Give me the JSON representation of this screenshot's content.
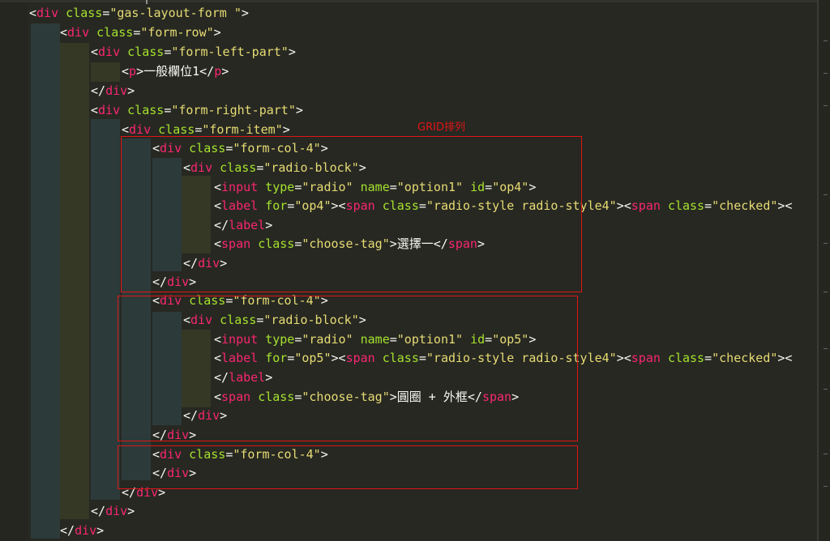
{
  "annotation": "GRID排列",
  "lines": [
    [
      [
        "p",
        "<"
      ],
      [
        "t",
        "div"
      ],
      [
        "p",
        " "
      ],
      [
        "a",
        "class"
      ],
      [
        "p",
        "="
      ],
      [
        "s",
        "\"gas-layout-form \""
      ],
      [
        "p",
        ">"
      ]
    ],
    [
      [
        "p",
        "<"
      ],
      [
        "t",
        "div"
      ],
      [
        "p",
        " "
      ],
      [
        "a",
        "class"
      ],
      [
        "p",
        "="
      ],
      [
        "s",
        "\"form-row\""
      ],
      [
        "p",
        ">"
      ]
    ],
    [
      [
        "p",
        "<"
      ],
      [
        "t",
        "div"
      ],
      [
        "p",
        " "
      ],
      [
        "a",
        "class"
      ],
      [
        "p",
        "="
      ],
      [
        "s",
        "\"form-left-part\""
      ],
      [
        "p",
        ">"
      ]
    ],
    [
      [
        "p",
        "<"
      ],
      [
        "t",
        "p"
      ],
      [
        "p",
        ">一般欄位1</"
      ],
      [
        "t",
        "p"
      ],
      [
        "p",
        ">"
      ]
    ],
    [
      [
        "p",
        "</"
      ],
      [
        "t",
        "div"
      ],
      [
        "p",
        ">"
      ]
    ],
    [
      [
        "p",
        "<"
      ],
      [
        "t",
        "div"
      ],
      [
        "p",
        " "
      ],
      [
        "a",
        "class"
      ],
      [
        "p",
        "="
      ],
      [
        "s",
        "\"form-right-part\""
      ],
      [
        "p",
        ">"
      ]
    ],
    [
      [
        "p",
        "<"
      ],
      [
        "t",
        "div"
      ],
      [
        "p",
        " "
      ],
      [
        "a",
        "class"
      ],
      [
        "p",
        "="
      ],
      [
        "s",
        "\"form-item\""
      ],
      [
        "p",
        ">"
      ]
    ],
    [
      [
        "p",
        "<"
      ],
      [
        "t",
        "div"
      ],
      [
        "p",
        " "
      ],
      [
        "a",
        "class"
      ],
      [
        "p",
        "="
      ],
      [
        "s",
        "\"form-col-4\""
      ],
      [
        "p",
        ">"
      ]
    ],
    [
      [
        "p",
        "<"
      ],
      [
        "t",
        "div"
      ],
      [
        "p",
        " "
      ],
      [
        "a",
        "class"
      ],
      [
        "p",
        "="
      ],
      [
        "s",
        "\"radio-block\""
      ],
      [
        "p",
        ">"
      ]
    ],
    [
      [
        "p",
        "<"
      ],
      [
        "t",
        "input"
      ],
      [
        "p",
        " "
      ],
      [
        "a",
        "type"
      ],
      [
        "p",
        "="
      ],
      [
        "s",
        "\"radio\""
      ],
      [
        "p",
        " "
      ],
      [
        "a",
        "name"
      ],
      [
        "p",
        "="
      ],
      [
        "s",
        "\"option1\""
      ],
      [
        "p",
        " "
      ],
      [
        "a",
        "id"
      ],
      [
        "p",
        "="
      ],
      [
        "s",
        "\"op4\""
      ],
      [
        "p",
        ">"
      ]
    ],
    [
      [
        "p",
        "<"
      ],
      [
        "t",
        "label"
      ],
      [
        "p",
        " "
      ],
      [
        "a",
        "for"
      ],
      [
        "p",
        "="
      ],
      [
        "s",
        "\"op4\""
      ],
      [
        "p",
        ">"
      ],
      [
        "p",
        "<"
      ],
      [
        "t",
        "span"
      ],
      [
        "p",
        " "
      ],
      [
        "a",
        "class"
      ],
      [
        "p",
        "="
      ],
      [
        "s",
        "\"radio-style radio-style4\""
      ],
      [
        "p",
        ">"
      ],
      [
        "p",
        "<"
      ],
      [
        "t",
        "span"
      ],
      [
        "p",
        " "
      ],
      [
        "a",
        "class"
      ],
      [
        "p",
        "="
      ],
      [
        "s",
        "\"checked\""
      ],
      [
        "p",
        "><"
      ]
    ],
    [
      [
        "p",
        "</"
      ],
      [
        "t",
        "label"
      ],
      [
        "p",
        ">"
      ]
    ],
    [
      [
        "p",
        "<"
      ],
      [
        "t",
        "span"
      ],
      [
        "p",
        " "
      ],
      [
        "a",
        "class"
      ],
      [
        "p",
        "="
      ],
      [
        "s",
        "\"choose-tag\""
      ],
      [
        "p",
        ">選擇一</"
      ],
      [
        "t",
        "span"
      ],
      [
        "p",
        ">"
      ]
    ],
    [
      [
        "p",
        "</"
      ],
      [
        "t",
        "div"
      ],
      [
        "p",
        ">"
      ]
    ],
    [
      [
        "p",
        "</"
      ],
      [
        "t",
        "div"
      ],
      [
        "p",
        ">"
      ]
    ],
    [
      [
        "p",
        "<"
      ],
      [
        "t",
        "div"
      ],
      [
        "p",
        " "
      ],
      [
        "a",
        "class"
      ],
      [
        "p",
        "="
      ],
      [
        "s",
        "\"form-col-4\""
      ],
      [
        "p",
        ">"
      ]
    ],
    [
      [
        "p",
        "<"
      ],
      [
        "t",
        "div"
      ],
      [
        "p",
        " "
      ],
      [
        "a",
        "class"
      ],
      [
        "p",
        "="
      ],
      [
        "s",
        "\"radio-block\""
      ],
      [
        "p",
        ">"
      ]
    ],
    [
      [
        "p",
        "<"
      ],
      [
        "t",
        "input"
      ],
      [
        "p",
        " "
      ],
      [
        "a",
        "type"
      ],
      [
        "p",
        "="
      ],
      [
        "s",
        "\"radio\""
      ],
      [
        "p",
        " "
      ],
      [
        "a",
        "name"
      ],
      [
        "p",
        "="
      ],
      [
        "s",
        "\"option1\""
      ],
      [
        "p",
        " "
      ],
      [
        "a",
        "id"
      ],
      [
        "p",
        "="
      ],
      [
        "s",
        "\"op5\""
      ],
      [
        "p",
        ">"
      ]
    ],
    [
      [
        "p",
        "<"
      ],
      [
        "t",
        "label"
      ],
      [
        "p",
        " "
      ],
      [
        "a",
        "for"
      ],
      [
        "p",
        "="
      ],
      [
        "s",
        "\"op5\""
      ],
      [
        "p",
        ">"
      ],
      [
        "p",
        "<"
      ],
      [
        "t",
        "span"
      ],
      [
        "p",
        " "
      ],
      [
        "a",
        "class"
      ],
      [
        "p",
        "="
      ],
      [
        "s",
        "\"radio-style radio-style4\""
      ],
      [
        "p",
        ">"
      ],
      [
        "p",
        "<"
      ],
      [
        "t",
        "span"
      ],
      [
        "p",
        " "
      ],
      [
        "a",
        "class"
      ],
      [
        "p",
        "="
      ],
      [
        "s",
        "\"checked\""
      ],
      [
        "p",
        "><"
      ]
    ],
    [
      [
        "p",
        "</"
      ],
      [
        "t",
        "label"
      ],
      [
        "p",
        ">"
      ]
    ],
    [
      [
        "p",
        "<"
      ],
      [
        "t",
        "span"
      ],
      [
        "p",
        " "
      ],
      [
        "a",
        "class"
      ],
      [
        "p",
        "="
      ],
      [
        "s",
        "\"choose-tag\""
      ],
      [
        "p",
        ">圓圈 + 外框</"
      ],
      [
        "t",
        "span"
      ],
      [
        "p",
        ">"
      ]
    ],
    [
      [
        "p",
        "</"
      ],
      [
        "t",
        "div"
      ],
      [
        "p",
        ">"
      ]
    ],
    [
      [
        "p",
        "</"
      ],
      [
        "t",
        "div"
      ],
      [
        "p",
        ">"
      ]
    ],
    [
      [
        "p",
        "<"
      ],
      [
        "t",
        "div"
      ],
      [
        "p",
        " "
      ],
      [
        "a",
        "class"
      ],
      [
        "p",
        "="
      ],
      [
        "s",
        "\"form-col-4\""
      ],
      [
        "p",
        ">"
      ]
    ],
    [
      [
        "p",
        "</"
      ],
      [
        "t",
        "div"
      ],
      [
        "p",
        ">"
      ]
    ],
    [
      [
        "p",
        "</"
      ],
      [
        "t",
        "div"
      ],
      [
        "p",
        ">"
      ]
    ],
    [
      [
        "p",
        "</"
      ],
      [
        "t",
        "div"
      ],
      [
        "p",
        ">"
      ]
    ],
    [
      [
        "p",
        "</"
      ],
      [
        "t",
        "div"
      ],
      [
        "p",
        ">"
      ]
    ]
  ]
}
